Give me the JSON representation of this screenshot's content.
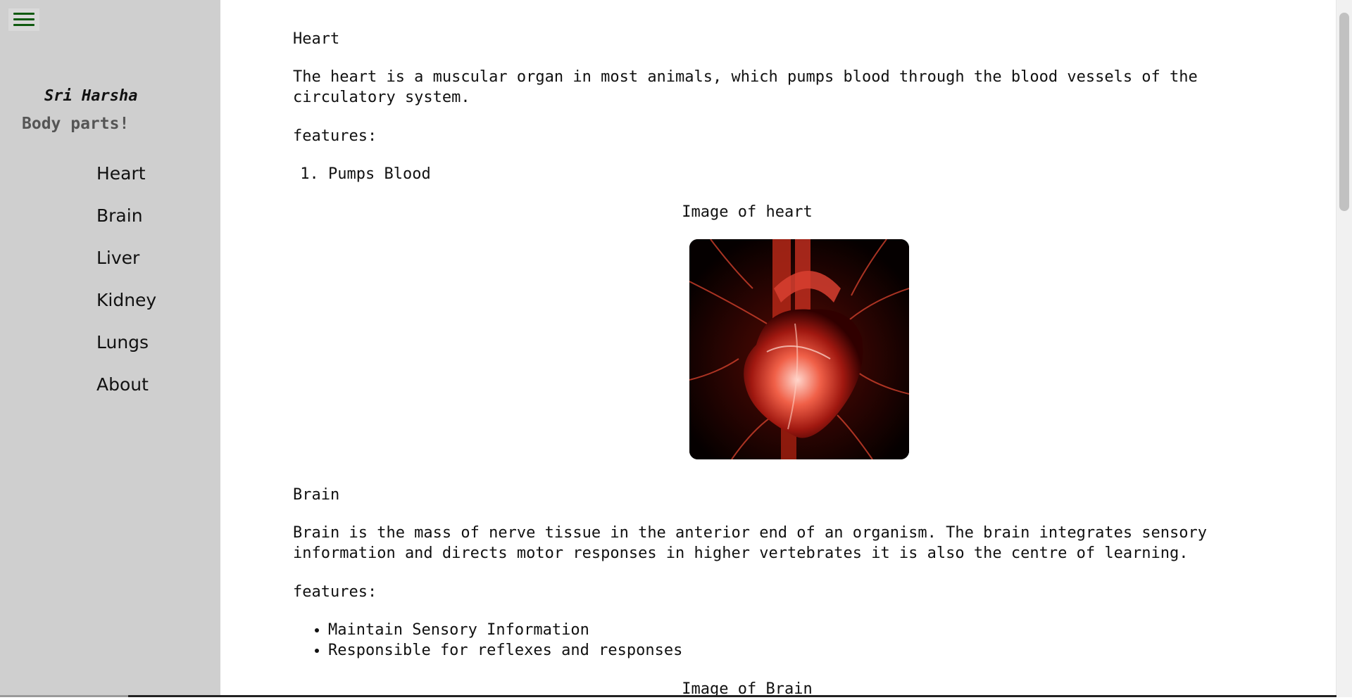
{
  "sidebar": {
    "author": "Sri Harsha",
    "subtitle": "Body parts!",
    "nav": [
      {
        "label": "Heart"
      },
      {
        "label": "Brain"
      },
      {
        "label": "Liver"
      },
      {
        "label": "Kidney"
      },
      {
        "label": "Lungs"
      },
      {
        "label": "About"
      }
    ]
  },
  "sections": {
    "heart": {
      "title": "Heart",
      "description": "The heart is a muscular organ in most animals, which pumps blood through the blood vessels of the circulatory system.",
      "features_label": "features:",
      "features": [
        "Pumps Blood"
      ],
      "image_caption": "Image of heart"
    },
    "brain": {
      "title": "Brain",
      "description": "Brain is the mass of nerve tissue in the anterior end of an organism. The brain integrates sensory information and directs motor responses in higher vertebrates it is also the centre of learning.",
      "features_label": "features:",
      "features": [
        "Maintain Sensory Information",
        "Responsible for reflexes and responses"
      ],
      "image_caption": "Image of Brain"
    }
  },
  "icons": {
    "menu": "hamburger-menu-icon"
  },
  "colors": {
    "sidebar_bg": "#cfcfcf",
    "menu_icon": "#0f5a0f",
    "subtitle": "#555555"
  }
}
